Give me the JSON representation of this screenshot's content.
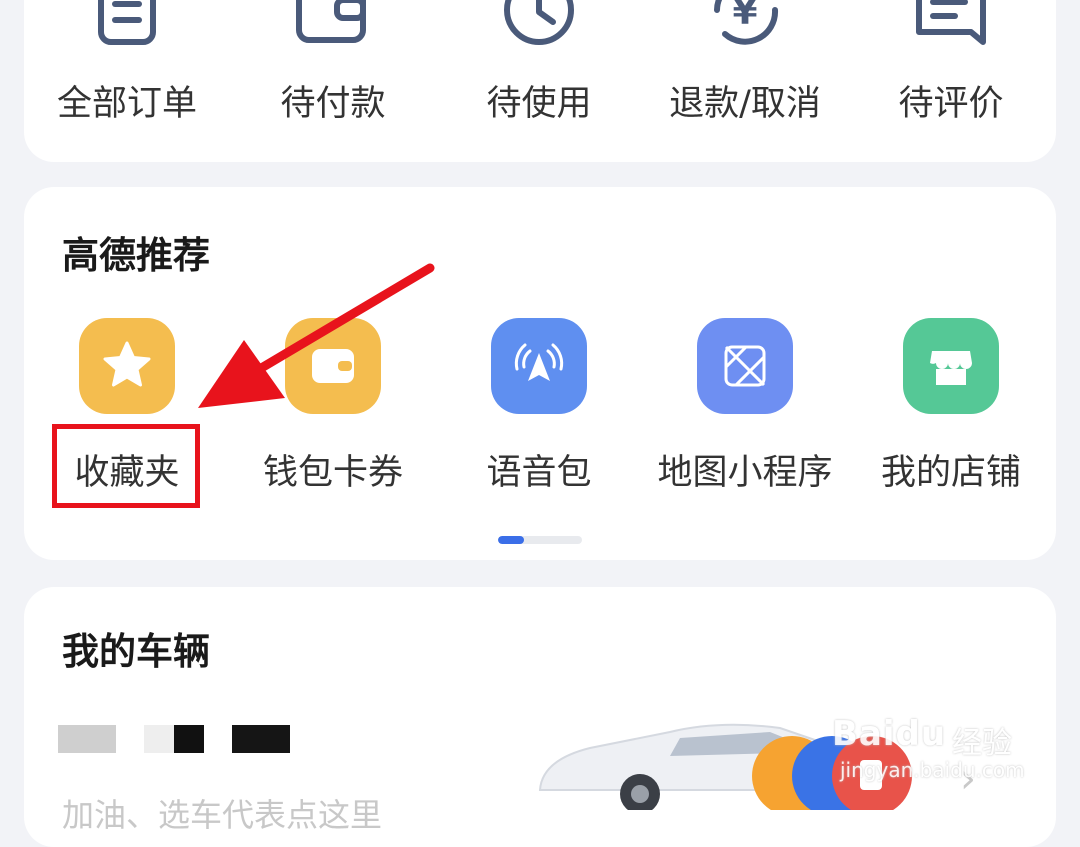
{
  "orders": {
    "items": [
      {
        "label": "全部订单",
        "icon": "order-list-icon"
      },
      {
        "label": "待付款",
        "icon": "wallet-icon"
      },
      {
        "label": "待使用",
        "icon": "clock-icon"
      },
      {
        "label": "退款/取消",
        "icon": "refund-yuan-icon"
      },
      {
        "label": "待评价",
        "icon": "comment-icon"
      }
    ]
  },
  "recommend": {
    "title": "高德推荐",
    "items": [
      {
        "label": "收藏夹",
        "icon": "star-icon",
        "color": "#f4bd4f"
      },
      {
        "label": "钱包卡券",
        "icon": "wallet-card-icon",
        "color": "#f4bd4f"
      },
      {
        "label": "语音包",
        "icon": "voice-navigation-icon",
        "color": "#5f8ff0"
      },
      {
        "label": "地图小程序",
        "icon": "map-miniprogram-icon",
        "color": "#6e8ff2"
      },
      {
        "label": "我的店铺",
        "icon": "shop-icon",
        "color": "#55c896"
      }
    ],
    "pager": {
      "active": 1,
      "total": 3
    }
  },
  "vehicles": {
    "title": "我的车辆",
    "subtitle": "加油、选车代表点这里"
  },
  "watermark": {
    "brand": "Baidu",
    "cn": "经验",
    "url": "jingyan.baidu.com"
  },
  "colors": {
    "accent": "#3a6ee8",
    "highlight": "#e8131c",
    "icon_stroke": "#4a5a7a"
  }
}
